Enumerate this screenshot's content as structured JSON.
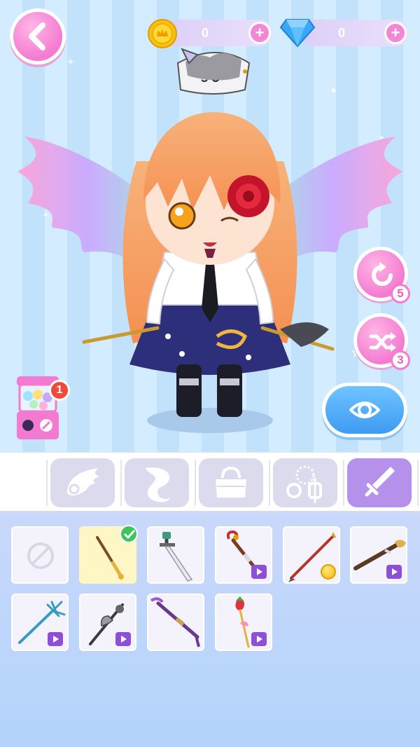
{
  "currency": {
    "coins": "0",
    "gems": "0",
    "add_coins_label": "+",
    "add_gems_label": "+"
  },
  "controls": {
    "undo_count": "5",
    "random_count": "3",
    "gacha_count": "1"
  },
  "icons": {
    "back": "chevron-left-icon",
    "coin": "coin-icon",
    "gem": "diamond-icon",
    "undo": "rotate-icon",
    "random": "shuffle-icon",
    "preview": "eye-icon",
    "gacha": "capsule-machine-icon"
  },
  "categories": [
    {
      "name": "wings",
      "icon": "wing-icon",
      "active": false
    },
    {
      "name": "tail",
      "icon": "tail-icon",
      "active": false
    },
    {
      "name": "bags",
      "icon": "handbag-icon",
      "active": false
    },
    {
      "name": "jewelry",
      "icon": "jewelry-icon",
      "active": false
    },
    {
      "name": "weapons",
      "icon": "sword-icon",
      "active": true
    }
  ],
  "items": [
    {
      "id": "none",
      "icon": "none-icon",
      "selected": false,
      "lock": "free"
    },
    {
      "id": "wand",
      "icon": "wand-icon",
      "selected": true,
      "lock": "free"
    },
    {
      "id": "sword",
      "icon": "sword-icon",
      "selected": false,
      "lock": "free"
    },
    {
      "id": "hook-staff",
      "icon": "hook-staff-icon",
      "selected": false,
      "lock": "ad"
    },
    {
      "id": "red-spear",
      "icon": "spear-icon",
      "selected": false,
      "lock": "coin"
    },
    {
      "id": "brush-staff",
      "icon": "staff-icon",
      "selected": false,
      "lock": "ad"
    },
    {
      "id": "trident",
      "icon": "trident-icon",
      "selected": false,
      "lock": "ad"
    },
    {
      "id": "halberd",
      "icon": "halberd-icon",
      "selected": false,
      "lock": "ad"
    },
    {
      "id": "scythe",
      "icon": "scythe-icon",
      "selected": false,
      "lock": "free"
    },
    {
      "id": "strawberry-wand",
      "icon": "strawberry-wand-icon",
      "selected": false,
      "lock": "ad"
    }
  ],
  "colors": {
    "accent_pink": "#f47bd0",
    "active_tab": "#b691ec",
    "inactive_tab": "#dcdbee",
    "panel_bg": "#c9d8fb",
    "selected_item": "#fff6c6",
    "ad_badge": "#8c4fd6",
    "check": "#3cc45d"
  }
}
